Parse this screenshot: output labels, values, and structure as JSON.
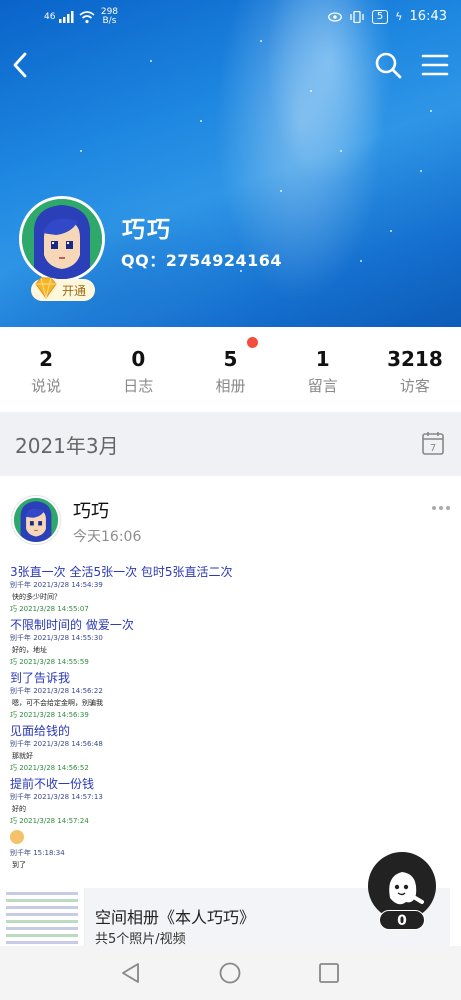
{
  "status_bar": {
    "signal": "46",
    "net_speed_value": "298",
    "net_speed_unit": "B/s",
    "battery": "5",
    "time": "16:43"
  },
  "topbar": {
    "back_icon": "chevron-left-icon",
    "search_icon": "search-icon",
    "menu_icon": "menu-icon"
  },
  "profile": {
    "nickname": "巧巧",
    "qq": "QQ：2754924164",
    "vip_label": "开通"
  },
  "stats": [
    {
      "value": "2",
      "label": "说说"
    },
    {
      "value": "0",
      "label": "日志"
    },
    {
      "value": "5",
      "label": "相册"
    },
    {
      "value": "1",
      "label": "留言"
    },
    {
      "value": "3218",
      "label": "访客"
    }
  ],
  "month": {
    "label": "2021年3月",
    "calendar_day": "7"
  },
  "post": {
    "author": "巧巧",
    "time": "今天16:06",
    "chat": [
      {
        "kind": "msg",
        "text": "3张直一次  全活5张一次  包时5张直活二次"
      },
      {
        "kind": "meta1",
        "text": "别千年 2021/3/28 14:54:39"
      },
      {
        "kind": "reply",
        "text": "快的多少时间？"
      },
      {
        "kind": "meta2",
        "text": "巧 2021/3/28 14:55:07"
      },
      {
        "kind": "msg",
        "text": "不限制时间的 做爱一次"
      },
      {
        "kind": "meta1",
        "text": "别千年 2021/3/28 14:55:30"
      },
      {
        "kind": "reply",
        "text": "好的，地址"
      },
      {
        "kind": "meta2",
        "text": "巧 2021/3/28 14:55:59"
      },
      {
        "kind": "msg",
        "text": "到了告诉我"
      },
      {
        "kind": "meta1",
        "text": "别千年 2021/3/28 14:56:22"
      },
      {
        "kind": "reply",
        "text": "嗯，可不会给定金啊，别骗我"
      },
      {
        "kind": "meta2",
        "text": "巧 2021/3/28 14:56:39"
      },
      {
        "kind": "msg",
        "text": "见面给钱的"
      },
      {
        "kind": "meta1",
        "text": "别千年 2021/3/28 14:56:48"
      },
      {
        "kind": "reply",
        "text": "那就好"
      },
      {
        "kind": "meta2",
        "text": "巧 2021/3/28 14:56:52"
      },
      {
        "kind": "msg",
        "text": "提前不收一份钱"
      },
      {
        "kind": "meta1",
        "text": "别千年 2021/3/28 14:57:13"
      },
      {
        "kind": "reply",
        "text": "好的"
      },
      {
        "kind": "meta2",
        "text": "巧 2021/3/28 14:57:24"
      },
      {
        "kind": "emoji",
        "text": ""
      },
      {
        "kind": "meta1",
        "text": "别千年    15:18:34"
      },
      {
        "kind": "reply",
        "text": "到了"
      }
    ],
    "album_title": "空间相册《本人巧巧》",
    "album_sub": "共5个照片/视频"
  },
  "fab": {
    "count": "0"
  },
  "colors": {
    "accent_red": "#f34d3c",
    "chat_blue": "#2a39b6",
    "chat_green": "#2f8c3e"
  }
}
